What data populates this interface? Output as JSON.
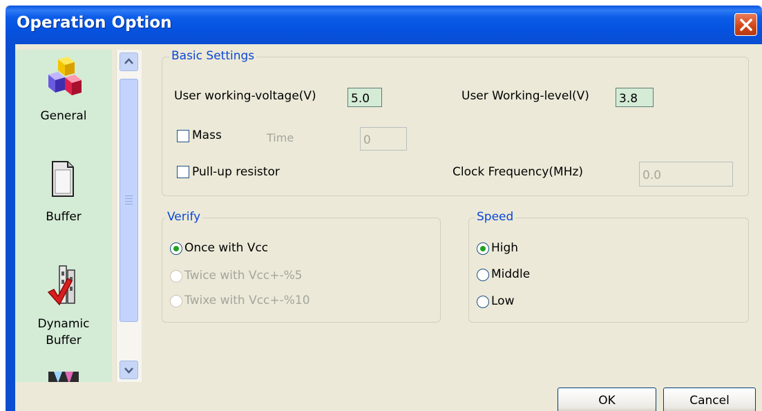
{
  "window": {
    "title": "Operation Option",
    "close_icon": "close-icon"
  },
  "sidebar": {
    "items": [
      {
        "label": "General",
        "icon": "cubes-icon"
      },
      {
        "label": "Buffer",
        "icon": "document-icon"
      },
      {
        "label": "Dynamic\nBuffer",
        "icon": "checkmark-icon"
      },
      {
        "label": "",
        "icon": "partial-icon"
      }
    ]
  },
  "basic_settings": {
    "legend": "Basic Settings",
    "voltage_label": "User working-voltage(V)",
    "voltage_value": "5.0",
    "level_label": "User Working-level(V)",
    "level_value": "3.8",
    "mass_label": "Mass",
    "time_label": "Time",
    "time_value": "0",
    "pullup_label": "Pull-up resistor",
    "clock_label": "Clock Frequency(MHz)",
    "clock_value": "0.0"
  },
  "verify": {
    "legend": "Verify",
    "options": [
      {
        "label": "Once with Vcc",
        "selected": true,
        "enabled": true
      },
      {
        "label": "Twice with Vcc+-%5",
        "selected": false,
        "enabled": false
      },
      {
        "label": "Twixe with Vcc+-%10",
        "selected": false,
        "enabled": false
      }
    ]
  },
  "speed": {
    "legend": "Speed",
    "options": [
      {
        "label": "High",
        "selected": true
      },
      {
        "label": "Middle",
        "selected": false
      },
      {
        "label": "Low",
        "selected": false
      }
    ]
  },
  "buttons": {
    "ok": "OK",
    "cancel": "Cancel"
  },
  "colors": {
    "accent": "#0b46d6",
    "titlebar": "#0553e1",
    "sidebar_bg": "#d4ebd6",
    "radio_dot": "#21a121"
  }
}
